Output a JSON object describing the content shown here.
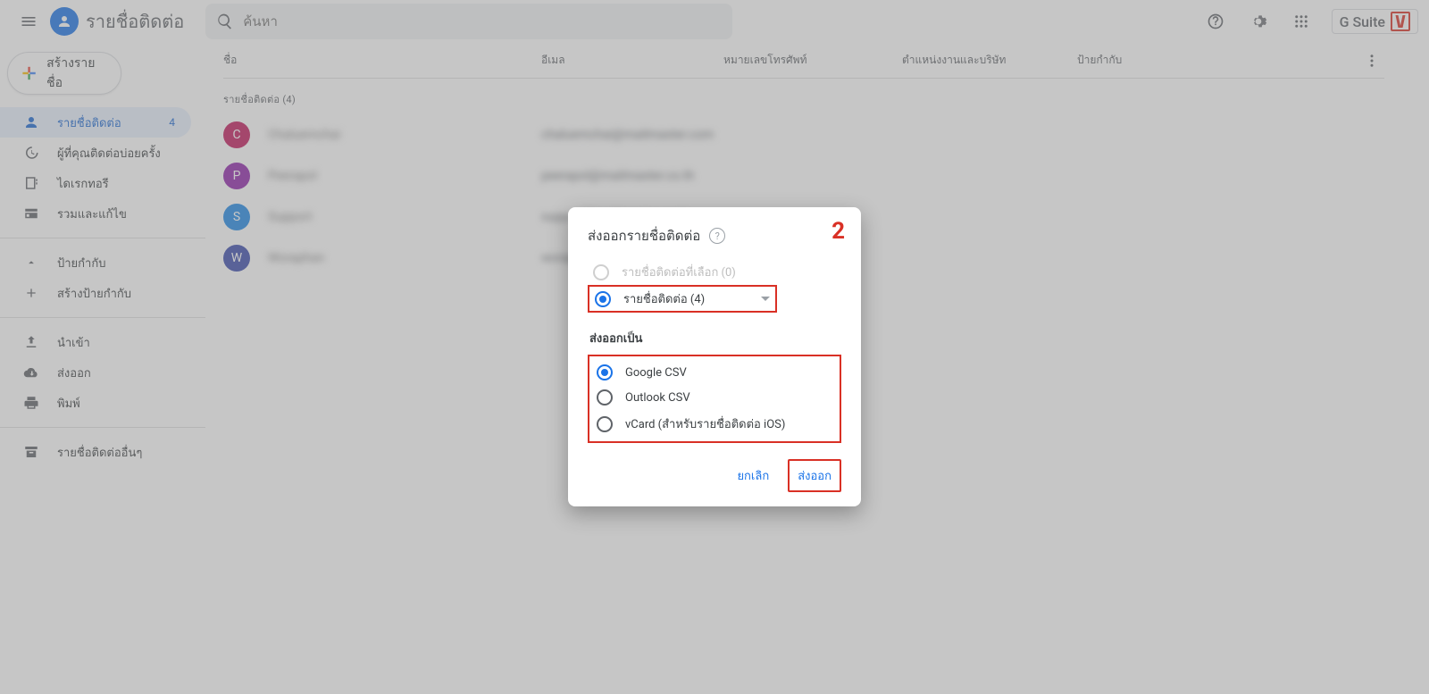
{
  "header": {
    "title": "รายชื่อติดต่อ",
    "search_placeholder": "ค้นหา",
    "gsuite_label": "G Suite"
  },
  "sidebar": {
    "create_label": "สร้างรายชื่อ",
    "items": {
      "contacts": {
        "label": "รายชื่อติดต่อ",
        "count": "4"
      },
      "frequent": {
        "label": "ผู้ที่คุณติดต่อบ่อยครั้ง"
      },
      "directory": {
        "label": "ไดเรกทอรี"
      },
      "merge": {
        "label": "รวมและแก้ไข"
      },
      "labels": {
        "label": "ป้ายกำกับ"
      },
      "create_label_item": {
        "label": "สร้างป้ายกำกับ"
      },
      "import": {
        "label": "นำเข้า"
      },
      "export": {
        "label": "ส่งออก"
      },
      "print": {
        "label": "พิมพ์"
      },
      "other": {
        "label": "รายชื่อติดต่ออื่นๆ"
      }
    }
  },
  "table": {
    "cols": {
      "name": "ชื่อ",
      "email": "อีเมล",
      "phone": "หมายเลขโทรศัพท์",
      "job": "ตำแหน่งงานและบริษัท",
      "label": "ป้ายกำกับ"
    },
    "section_title": "รายชื่อติดต่อ (4)",
    "rows": [
      {
        "initial": "C",
        "avatar_class": "av-c",
        "name": "Chaluemchai",
        "email": "chaluemchai@mailmaster.com"
      },
      {
        "initial": "P",
        "avatar_class": "av-p",
        "name": "Peerapol",
        "email": "peerapol@mailmaster.co.th"
      },
      {
        "initial": "S",
        "avatar_class": "av-s",
        "name": "Support",
        "email": "support@mailmaster.co.th"
      },
      {
        "initial": "W",
        "avatar_class": "av-w",
        "name": "Woraphan",
        "email": "woraphan@mailmaster.co.th"
      }
    ]
  },
  "modal": {
    "title": "ส่งออกรายชื่อติดต่อ",
    "step": "2",
    "source": {
      "selected": {
        "label": "รายชื่อติดต่อที่เลือก (0)"
      },
      "all": {
        "label": "รายชื่อติดต่อ (4)"
      }
    },
    "format_label": "ส่งออกเป็น",
    "formats": {
      "google": "Google CSV",
      "outlook": "Outlook CSV",
      "vcard": "vCard (สำหรับรายชื่อติดต่อ iOS)"
    },
    "actions": {
      "cancel": "ยกเลิก",
      "export": "ส่งออก"
    }
  }
}
